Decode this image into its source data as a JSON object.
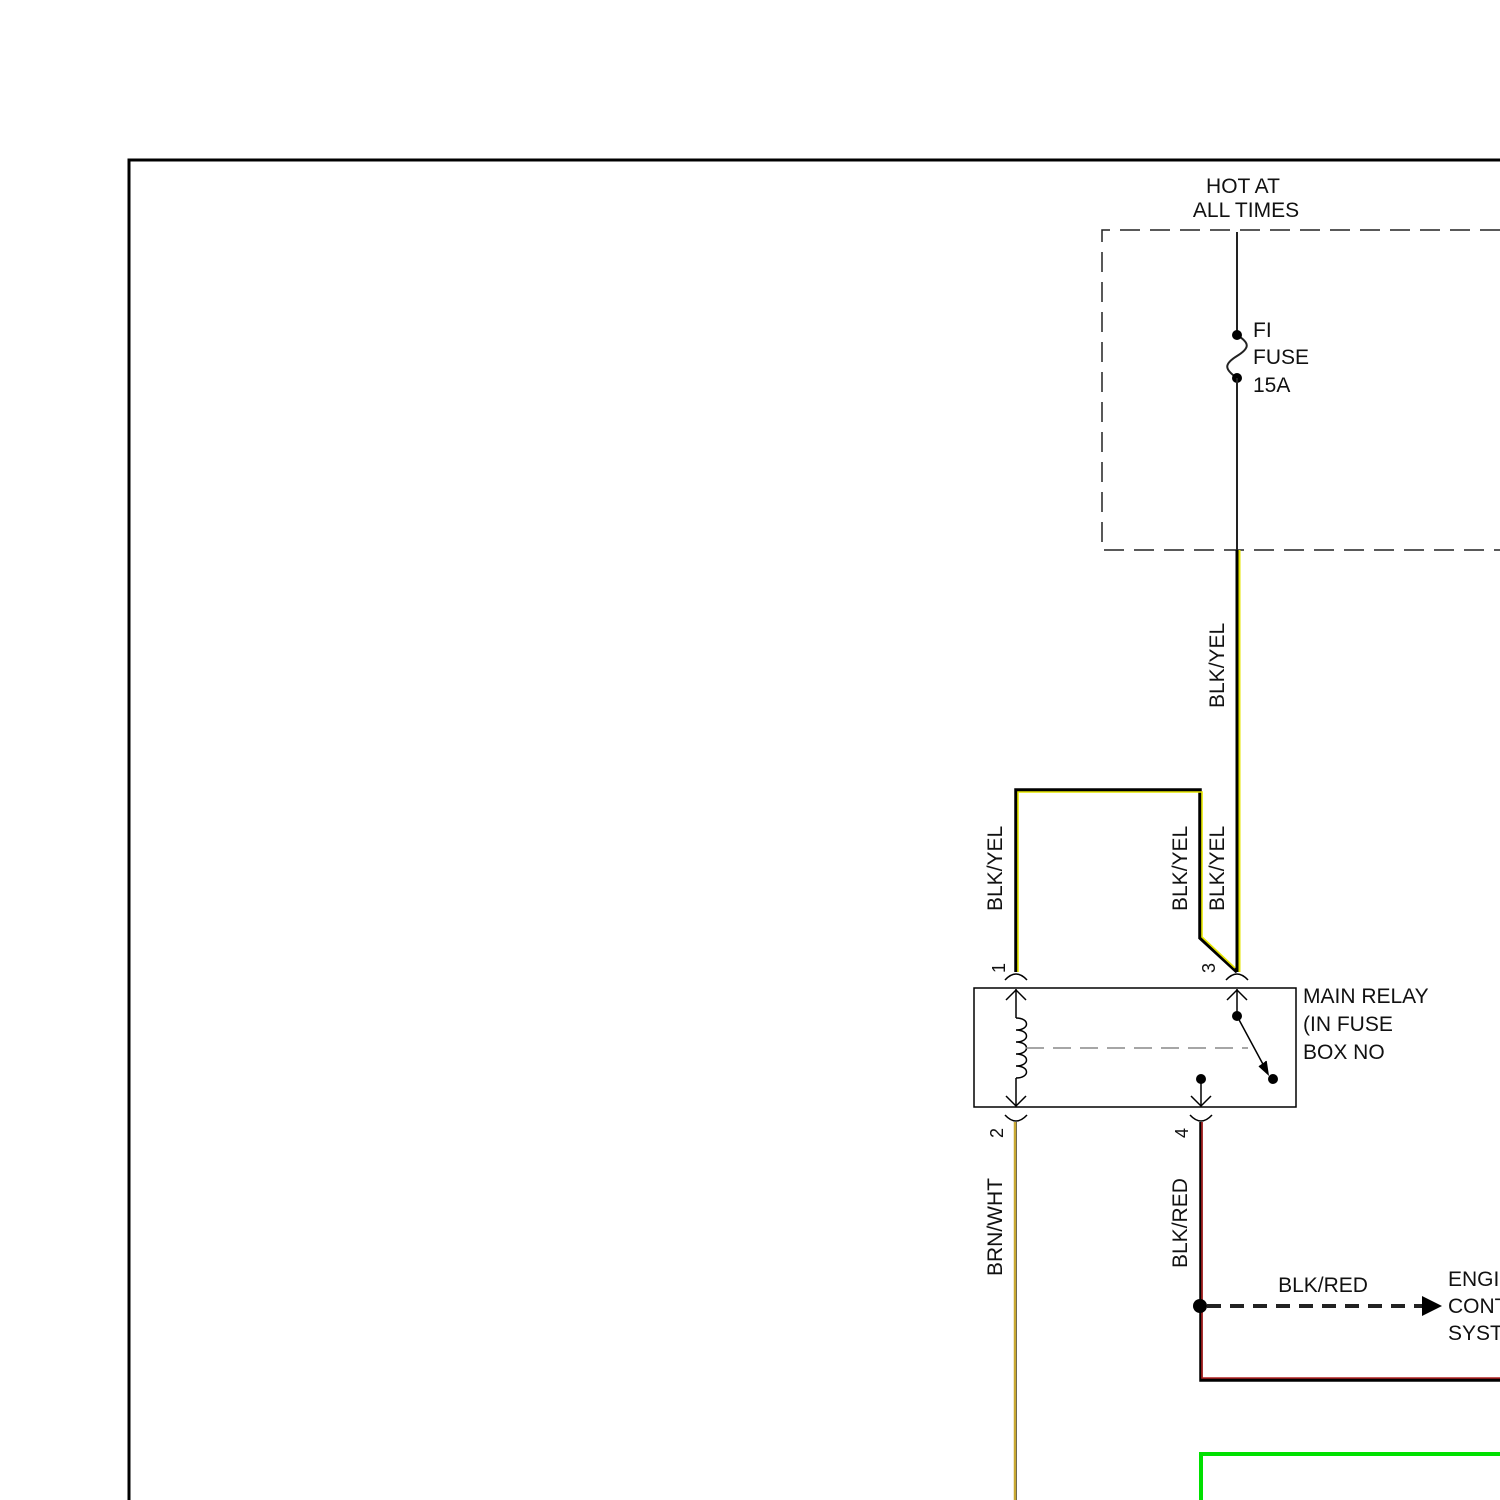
{
  "power": {
    "line1": "HOT AT",
    "line2": "ALL TIMES"
  },
  "fuse": {
    "line1": "FI",
    "line2": "FUSE",
    "line3": "15A"
  },
  "wires": {
    "feed": "BLK/YEL",
    "pin1_wire": "BLK/YEL",
    "pin3_wire_a": "BLK/YEL",
    "pin3_wire_b": "BLK/YEL",
    "pin2_wire": "BRN/WHT",
    "pin4_wire": "BLK/RED",
    "branch_wire": "BLK/RED"
  },
  "relay": {
    "line1": "MAIN RELAY",
    "line2": "(IN FUSE",
    "line3": "BOX NO",
    "pins": {
      "p1": "1",
      "p2": "2",
      "p3": "3",
      "p4": "4"
    }
  },
  "destination": {
    "line1": "ENGI",
    "line2": "CONT",
    "line3": "SYST"
  },
  "colors": {
    "blk_yel": "#e6e600",
    "brn_wht": "#c8a832",
    "blk_red": "#b02020",
    "green": "#00e000",
    "ink": "#111111"
  }
}
